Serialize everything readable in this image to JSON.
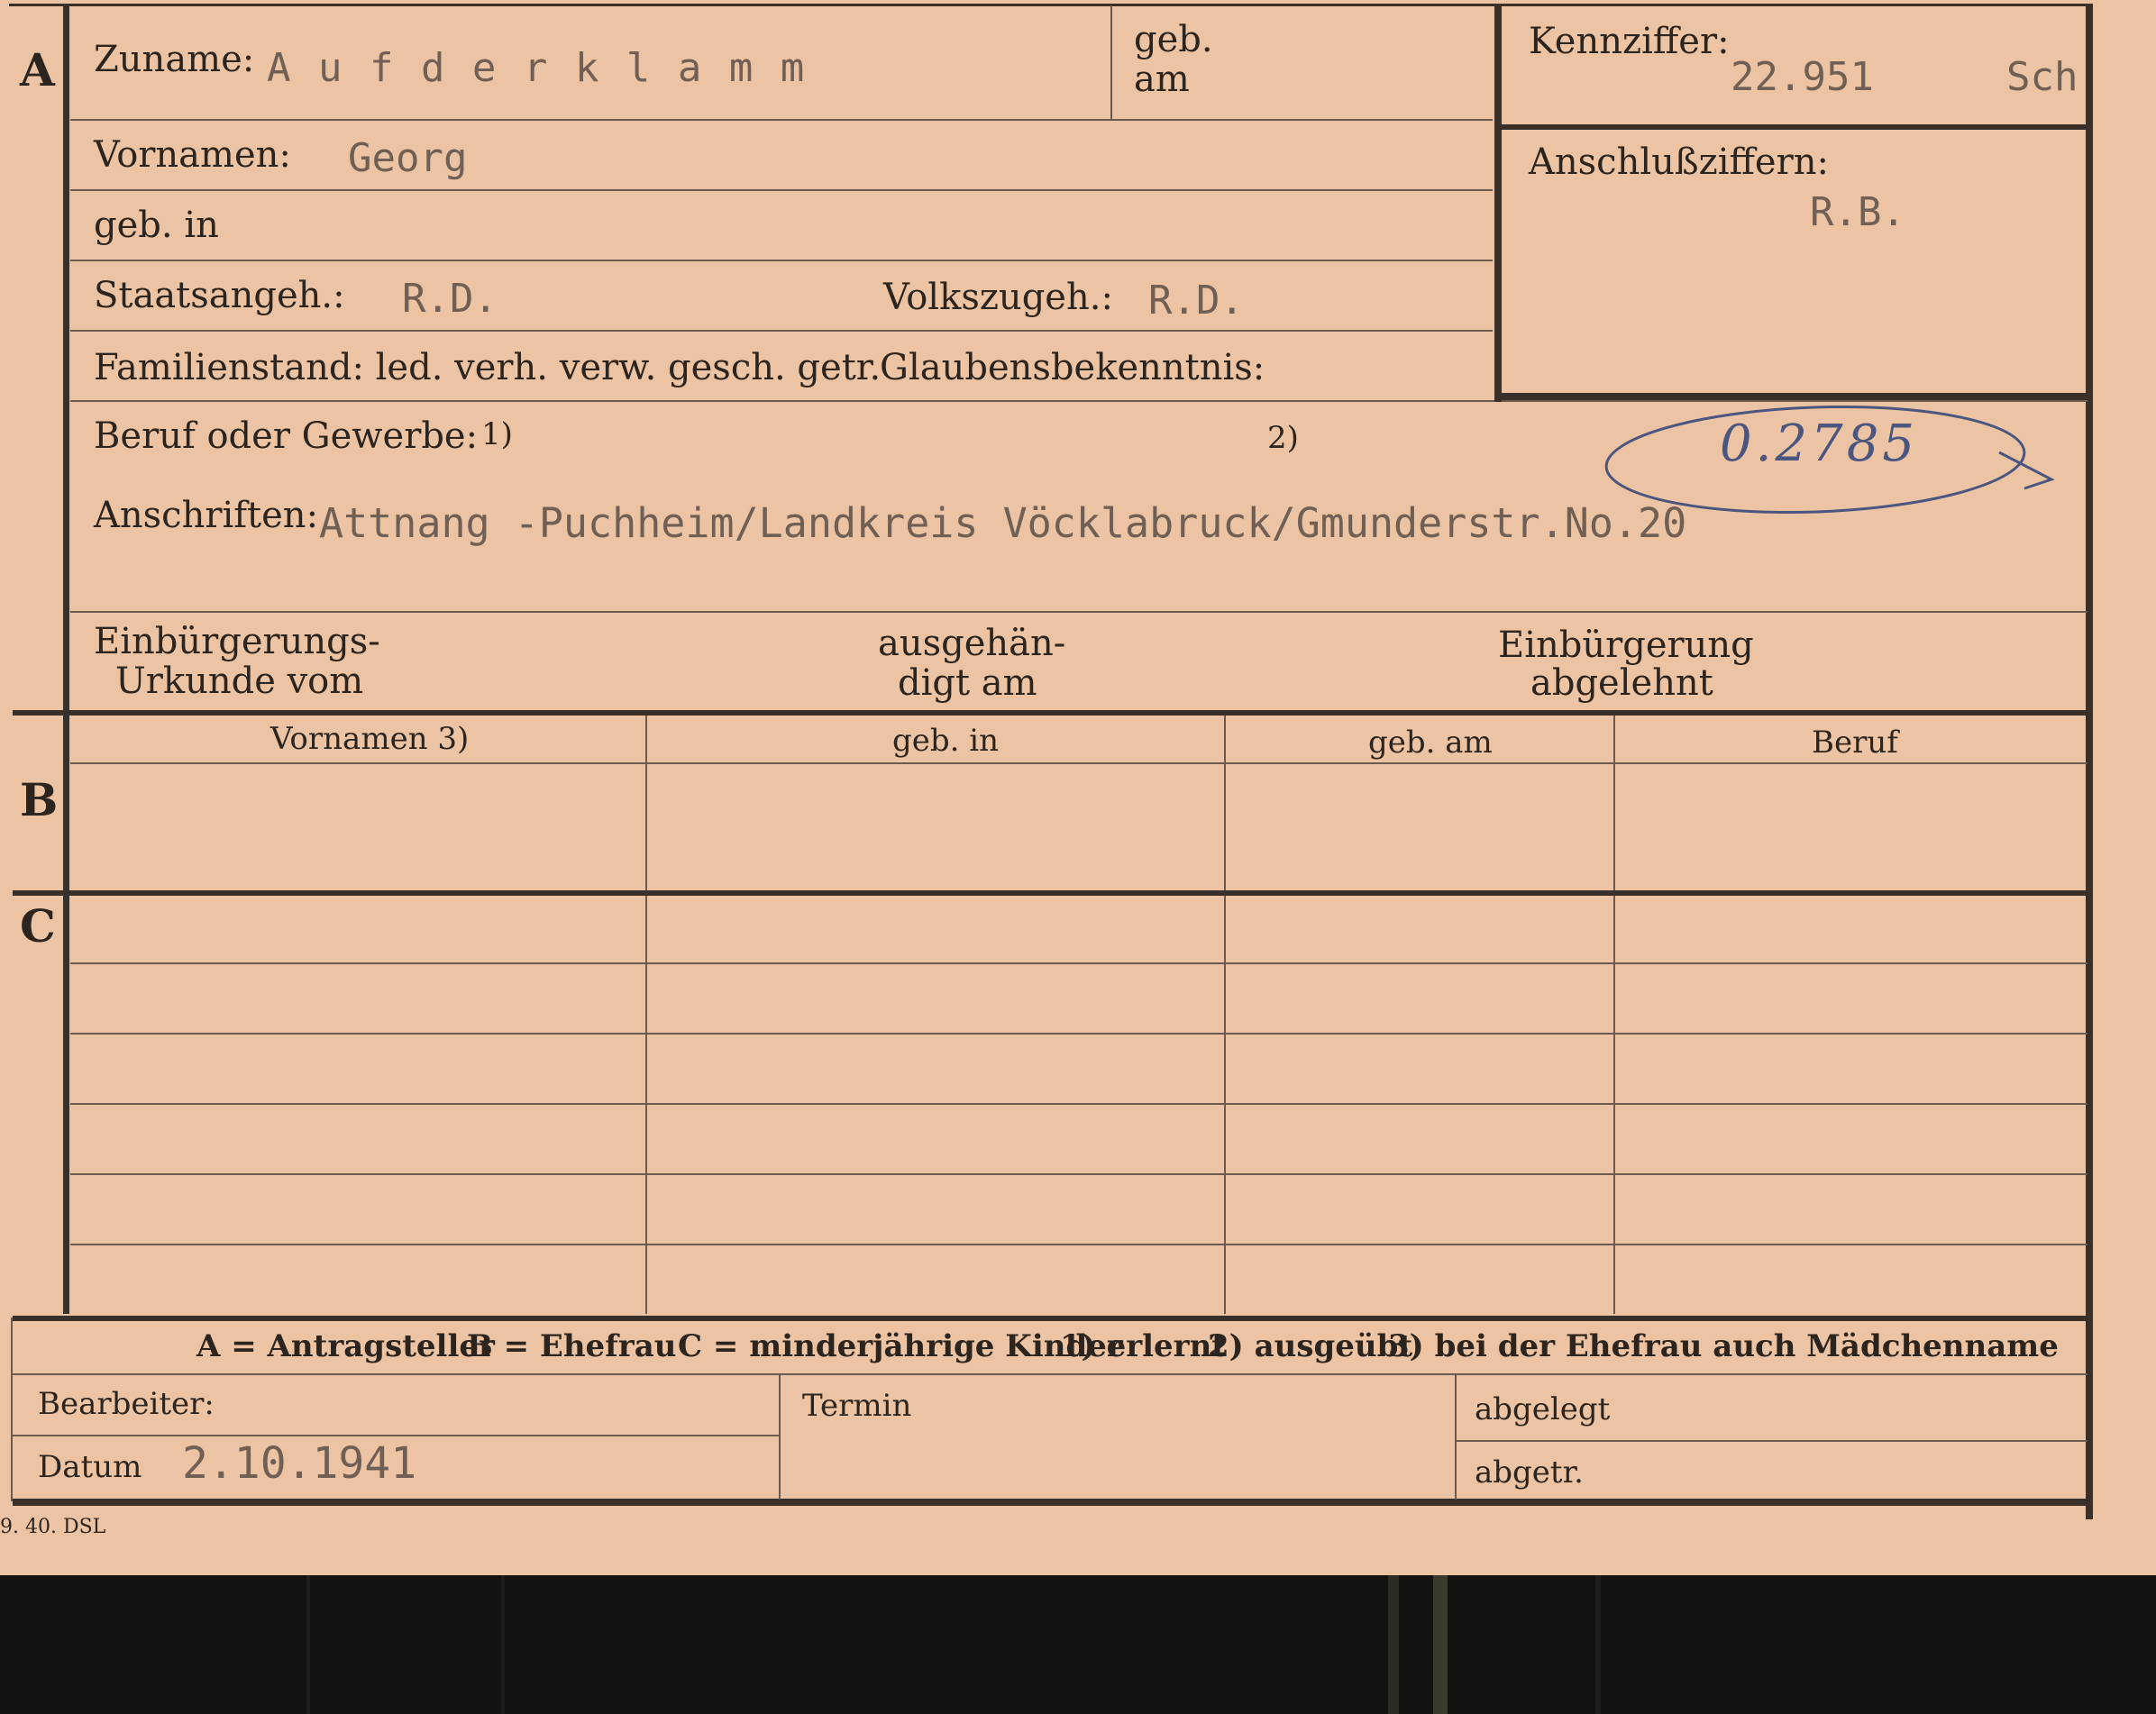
{
  "section_a": {
    "letter": "A",
    "surname_label": "Zuname:",
    "surname_value": "A u f d e r k l a m m",
    "birth_date_label_1": "geb.",
    "birth_date_label_2": "am",
    "given_names_label": "Vornamen:",
    "given_names_value": "Georg",
    "birthplace_label": "geb. in",
    "citizenship_label": "Staatsangeh.:",
    "citizenship_value": "R.D.",
    "ethnicity_label": "Volkszugeh.:",
    "ethnicity_value": "R.D.",
    "marital_label": "Familienstand: led. verh. verw. gesch. getr.",
    "religion_label": "Glaubensbekenntnis:",
    "occupation_label": "Beruf oder Gewerbe:",
    "occupation_note_1": "1)",
    "occupation_note_2": "2)",
    "addresses_label": "Anschriften:",
    "addresses_value": "Attnang -Puchheim/Landkreis Vöcklabruck/Gmunderstr.No.20",
    "cert_label_1": "Einbürgerungs-",
    "cert_label_2": "Urkunde vom",
    "handed_label_1": "ausgehän-",
    "handed_label_2": "digt am",
    "refused_label_1": "Einbürgerung",
    "refused_label_2": "abgelehnt"
  },
  "id_box": {
    "kennziffer_label": "Kennziffer:",
    "kennziffer_value": "22.951",
    "kennziffer_suffix": "Sch",
    "anschluss_label": "Anschlußziffern:",
    "anschluss_value": "R.B.",
    "handwritten_number": "0.2785"
  },
  "section_b": {
    "letter": "B",
    "columns": [
      "Vornamen 3)",
      "geb. in",
      "geb. am",
      "Beruf"
    ]
  },
  "section_c": {
    "letter": "C"
  },
  "legend": {
    "items": [
      "A = Antragsteller",
      "B = Ehefrau",
      "C = minderjährige Kinder",
      "1) erlernt",
      "2) ausgeübt",
      "3) bei der Ehefrau auch Mädchenname"
    ]
  },
  "footer": {
    "clerk_label": "Bearbeiter:",
    "date_label": "Datum",
    "date_value": "2.10.1941",
    "deadline_label": "Termin",
    "filed_label": "abgelegt",
    "removed_label": "abgetr."
  },
  "printer_mark": "9. 40. DSL",
  "colors": {
    "card": "#edc4a3",
    "ink": "#2c241e",
    "typewriter": "#6f5f55",
    "pencil": "#4a5580",
    "background": "#151311"
  }
}
